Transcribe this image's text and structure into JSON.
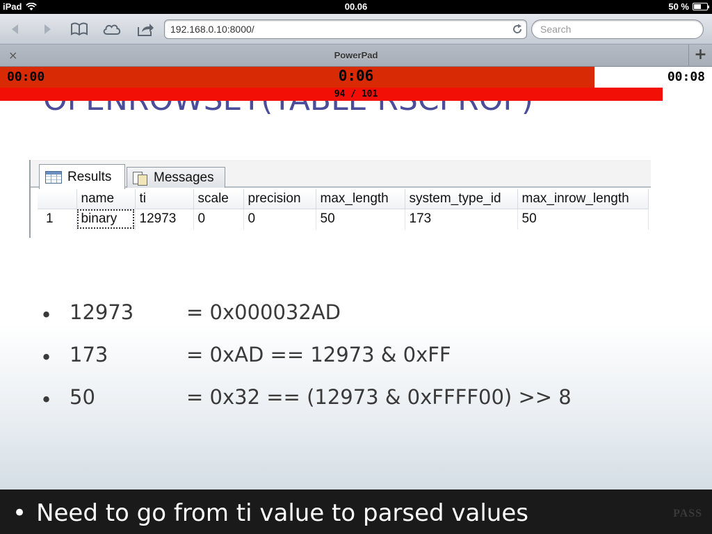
{
  "status_bar": {
    "device": "iPad",
    "clock": "00.06",
    "battery_text": "50 %",
    "battery_level": 0.5
  },
  "toolbar": {
    "url": "192.168.0.10:8000/",
    "search_placeholder": "Search",
    "icons": [
      "back-arrow-icon",
      "forward-arrow-icon",
      "bookmarks-icon",
      "icloud-tabs-icon",
      "share-icon",
      "reload-icon"
    ]
  },
  "tab_bar": {
    "close_symbol": "×",
    "title": "PowerPad",
    "add_symbol": "+"
  },
  "timer": {
    "start": "00:00",
    "current": "0:06",
    "end": "00:08",
    "elapsed_fraction": 0.835,
    "color": "#d72a05"
  },
  "progress": {
    "label": "94 / 101",
    "current": 94,
    "total": 101,
    "color": "#f20f05"
  },
  "slide": {
    "heading": "OPENROWSET(TABLE RSCPROP)",
    "results_tab": "Results",
    "messages_tab": "Messages",
    "grid": {
      "columns": [
        "",
        "name",
        "ti",
        "scale",
        "precision",
        "max_length",
        "system_type_id",
        "max_inrow_length"
      ],
      "rows": [
        [
          "1",
          "binary",
          "12973",
          "0",
          "0",
          "50",
          "173",
          "50"
        ]
      ]
    },
    "bullets": [
      {
        "dot": "•",
        "num": "12973",
        "expr": "= 0x000032AD"
      },
      {
        "dot": "•",
        "num": "173",
        "expr": "= 0xAD == 12973 & 0xFF"
      },
      {
        "dot": "•",
        "num": "50",
        "expr": "= 0x32 == (12973 & 0xFFFF00) >> 8"
      }
    ],
    "caption": {
      "dot": "•",
      "text": "Need to go from ti value to parsed values"
    },
    "logo": "PASS"
  }
}
